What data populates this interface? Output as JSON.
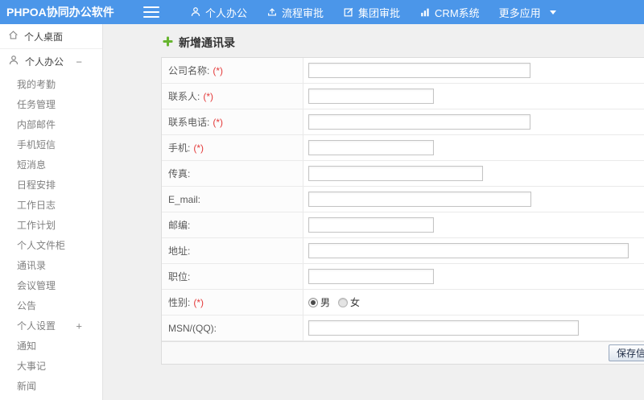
{
  "colors": {
    "header_blue": "#4b96e9",
    "required_red": "#e43b3b",
    "add_icon_green": "#67b52f",
    "content_bg": "#f0f0f0"
  },
  "header": {
    "logo": "PHPOA协同办公软件",
    "nav": [
      {
        "label": "个人办公",
        "icon": "user-icon"
      },
      {
        "label": "流程审批",
        "icon": "flow-approve-icon"
      },
      {
        "label": "集团审批",
        "icon": "group-approve-icon"
      },
      {
        "label": "CRM系统",
        "icon": "crm-chart-icon"
      },
      {
        "label": "更多应用",
        "icon": "caret-down-icon"
      }
    ]
  },
  "sidebar": {
    "items": [
      {
        "label": "个人桌面",
        "level": "top",
        "icon": "home-icon",
        "toggle": ""
      },
      {
        "label": "个人办公",
        "level": "top",
        "icon": "user-icon",
        "toggle": "−"
      },
      {
        "label": "我的考勤",
        "level": "sub",
        "icon": "",
        "toggle": ""
      },
      {
        "label": "任务管理",
        "level": "sub",
        "icon": "",
        "toggle": ""
      },
      {
        "label": "内部邮件",
        "level": "sub",
        "icon": "",
        "toggle": ""
      },
      {
        "label": "手机短信",
        "level": "sub",
        "icon": "",
        "toggle": ""
      },
      {
        "label": "短消息",
        "level": "sub",
        "icon": "",
        "toggle": ""
      },
      {
        "label": "日程安排",
        "level": "sub",
        "icon": "",
        "toggle": ""
      },
      {
        "label": "工作日志",
        "level": "sub",
        "icon": "",
        "toggle": ""
      },
      {
        "label": "工作计划",
        "level": "sub",
        "icon": "",
        "toggle": ""
      },
      {
        "label": "个人文件柜",
        "level": "sub",
        "icon": "",
        "toggle": ""
      },
      {
        "label": "通讯录",
        "level": "sub",
        "icon": "",
        "toggle": ""
      },
      {
        "label": "会议管理",
        "level": "sub",
        "icon": "",
        "toggle": ""
      },
      {
        "label": "公告",
        "level": "sub",
        "icon": "",
        "toggle": ""
      },
      {
        "label": "个人设置",
        "level": "sub",
        "icon": "",
        "toggle": "+"
      },
      {
        "label": "通知",
        "level": "sub",
        "icon": "",
        "toggle": ""
      },
      {
        "label": "大事记",
        "level": "sub",
        "icon": "",
        "toggle": ""
      },
      {
        "label": "新闻",
        "level": "sub",
        "icon": "",
        "toggle": ""
      }
    ]
  },
  "main": {
    "title": "新增通讯录",
    "title_icon": "add-plus-icon",
    "form": {
      "rows": [
        {
          "name": "company-name",
          "label": "公司名称:",
          "required": "(*)",
          "type": "text",
          "value": "",
          "input_width": 276
        },
        {
          "name": "contact-person",
          "label": "联系人:",
          "required": "(*)",
          "type": "text",
          "value": "",
          "input_width": 156
        },
        {
          "name": "contact-phone",
          "label": "联系电话:",
          "required": "(*)",
          "type": "text",
          "value": "",
          "input_width": 276
        },
        {
          "name": "mobile",
          "label": "手机:",
          "required": "(*)",
          "type": "text",
          "value": "",
          "input_width": 156
        },
        {
          "name": "fax",
          "label": "传真:",
          "required": "",
          "type": "text",
          "value": "",
          "input_width": 217
        },
        {
          "name": "email",
          "label": "E_mail:",
          "required": "",
          "type": "text",
          "value": "",
          "input_width": 277
        },
        {
          "name": "zipcode",
          "label": "邮编:",
          "required": "",
          "type": "text",
          "value": "",
          "input_width": 156
        },
        {
          "name": "address",
          "label": "地址:",
          "required": "",
          "type": "text",
          "value": "",
          "input_width": 398
        },
        {
          "name": "position",
          "label": "职位:",
          "required": "",
          "type": "text",
          "value": "",
          "input_width": 156
        },
        {
          "name": "gender",
          "label": "性别:",
          "required": "(*)",
          "type": "radio",
          "options": [
            {
              "label": "男",
              "checked": true
            },
            {
              "label": "女",
              "checked": false
            }
          ]
        },
        {
          "name": "msn-qq",
          "label": "MSN/(QQ):",
          "required": "",
          "type": "text",
          "value": "",
          "input_width": 336
        }
      ],
      "save_label": "保存信息"
    }
  }
}
